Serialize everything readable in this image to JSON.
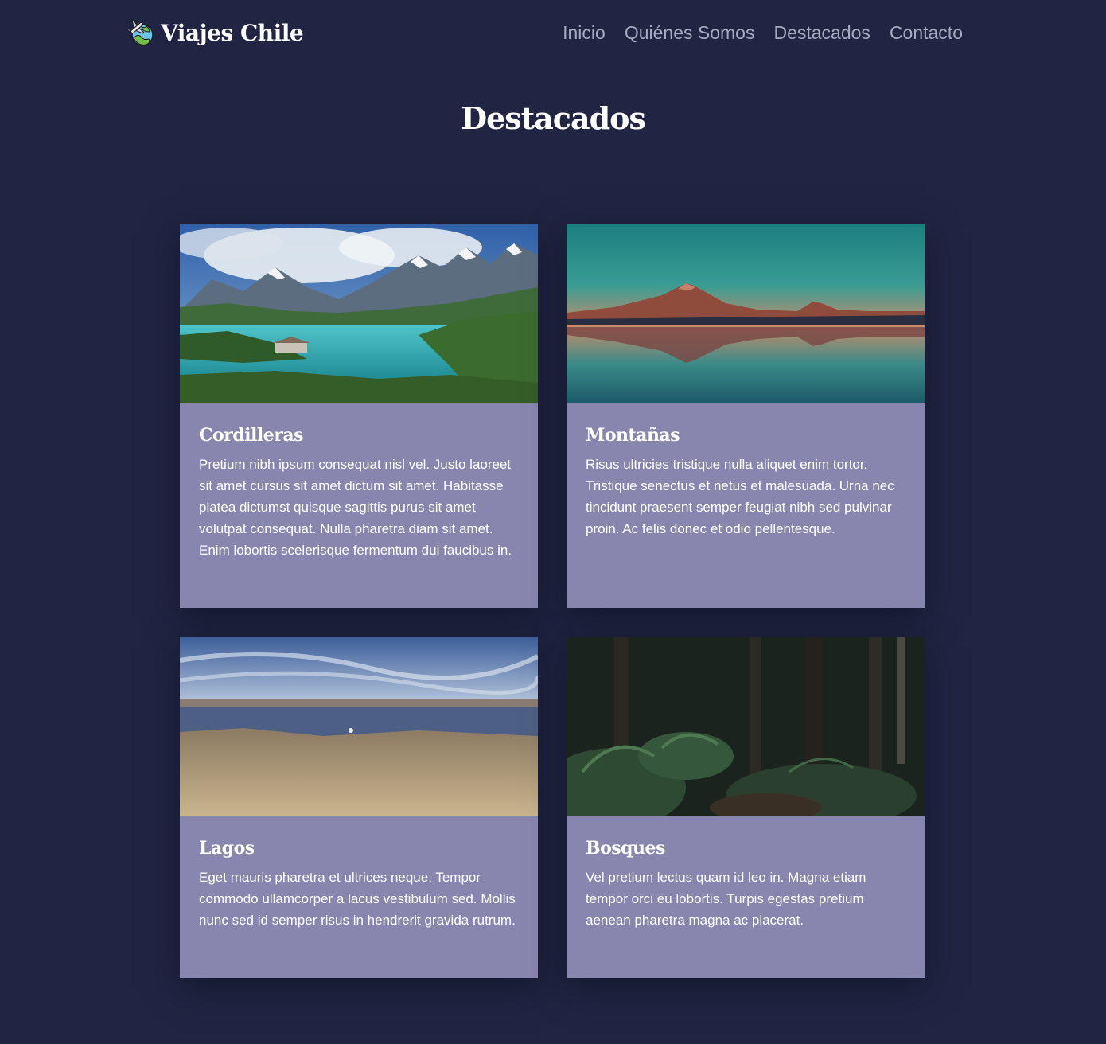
{
  "brand": {
    "name": "Viajes Chile",
    "logo_icon": "plane-globe-icon"
  },
  "nav": {
    "items": [
      {
        "label": "Inicio"
      },
      {
        "label": "Quiénes Somos"
      },
      {
        "label": "Destacados"
      },
      {
        "label": "Contacto"
      }
    ]
  },
  "section": {
    "title": "Destacados"
  },
  "colors": {
    "page_background": "#212543",
    "card_background": "#8886ae",
    "nav_link": "#a6a9c0"
  },
  "cards": [
    {
      "title": "Cordilleras",
      "text": "Pretium nibh ipsum consequat nisl vel. Justo laoreet sit amet cursus sit amet dictum sit amet. Habitasse platea dictumst quisque sagittis purus sit amet volutpat consequat. Nulla pharetra diam sit amet. Enim lobortis scelerisque fermentum dui faucibus in.",
      "image": "mountain-lake-photo"
    },
    {
      "title": "Montañas",
      "text": "Risus ultricies tristique nulla aliquet enim tortor. Tristique senectus et netus et malesuada. Urna nec tincidunt praesent semper feugiat nibh sed pulvinar proin. Ac felis donec et odio pellentesque.",
      "image": "volcano-reflection-photo"
    },
    {
      "title": "Lagos",
      "text": "Eget mauris pharetra et ultrices neque. Tempor commodo ullamcorper a lacus vestibulum sed. Mollis nunc sed id semper risus in hendrerit gravida rutrum.",
      "image": "salt-lake-photo"
    },
    {
      "title": "Bosques",
      "text": "Vel pretium lectus quam id leo in. Magna etiam tempor orci eu lobortis. Turpis egestas pretium aenean pharetra magna ac placerat.",
      "image": "forest-photo"
    }
  ]
}
